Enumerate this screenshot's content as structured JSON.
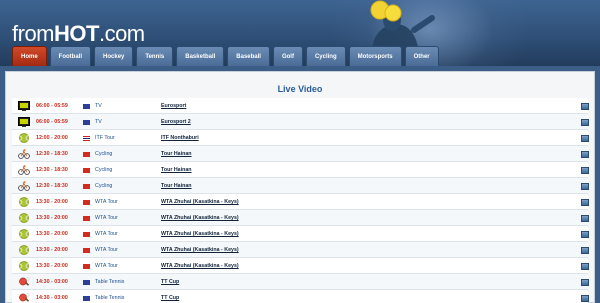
{
  "site": {
    "logo_prefix": "from",
    "logo_bold": "HOT",
    "logo_suffix": ".com"
  },
  "nav": {
    "tabs": [
      {
        "label": "Home",
        "active": true
      },
      {
        "label": "Football",
        "active": false
      },
      {
        "label": "Hockey",
        "active": false
      },
      {
        "label": "Tennis",
        "active": false
      },
      {
        "label": "Basketball",
        "active": false
      },
      {
        "label": "Baseball",
        "active": false
      },
      {
        "label": "Golf",
        "active": false
      },
      {
        "label": "Cycling",
        "active": false
      },
      {
        "label": "Motorsports",
        "active": false
      },
      {
        "label": "Other",
        "active": false
      }
    ]
  },
  "main": {
    "title": "Live Video",
    "rows": [
      {
        "icon": "tv-icon",
        "time": "06:00 - 05:59",
        "flag": "eu",
        "category": "TV",
        "event": "Eurosport"
      },
      {
        "icon": "tv-icon",
        "time": "06:00 - 05:59",
        "flag": "eu",
        "category": "TV",
        "event": "Eurosport 2"
      },
      {
        "icon": "tennis-ball-icon",
        "time": "12:00 - 20:00",
        "flag": "th",
        "category": "ITF Tour",
        "event": "ITF Nonthaburi"
      },
      {
        "icon": "cycling-icon",
        "time": "12:30 - 18:30",
        "flag": "cn",
        "category": "Cycling",
        "event": "Tour Hainan"
      },
      {
        "icon": "cycling-icon",
        "time": "12:30 - 18:30",
        "flag": "cn",
        "category": "Cycling",
        "event": "Tour Hainan"
      },
      {
        "icon": "cycling-icon",
        "time": "12:30 - 18:30",
        "flag": "cn",
        "category": "Cycling",
        "event": "Tour Hainan"
      },
      {
        "icon": "tennis-ball-icon",
        "time": "13:30 - 20:00",
        "flag": "cn",
        "category": "WTA Tour",
        "event": "WTA Zhuhai (Kasatkina - Keys)"
      },
      {
        "icon": "tennis-ball-icon",
        "time": "13:30 - 20:00",
        "flag": "cn",
        "category": "WTA Tour",
        "event": "WTA Zhuhai (Kasatkina - Keys)"
      },
      {
        "icon": "tennis-ball-icon",
        "time": "13:30 - 20:00",
        "flag": "cn",
        "category": "WTA Tour",
        "event": "WTA Zhuhai (Kasatkina - Keys)"
      },
      {
        "icon": "tennis-ball-icon",
        "time": "13:30 - 20:00",
        "flag": "cn",
        "category": "WTA Tour",
        "event": "WTA Zhuhai (Kasatkina - Keys)"
      },
      {
        "icon": "tennis-ball-icon",
        "time": "13:30 - 20:00",
        "flag": "cn",
        "category": "WTA Tour",
        "event": "WTA Zhuhai (Kasatkina - Keys)"
      },
      {
        "icon": "table-tennis-icon",
        "time": "14:30 - 03:00",
        "flag": "eu",
        "category": "Table Tennis",
        "event": "TT Cup"
      },
      {
        "icon": "table-tennis-icon",
        "time": "14:30 - 03:00",
        "flag": "eu",
        "category": "Table Tennis",
        "event": "TT Cup"
      }
    ]
  },
  "colors": {
    "accent": "#c62a1a",
    "link": "#1d4f90",
    "title": "#2a5d9a",
    "active_tab": "#b83418"
  }
}
